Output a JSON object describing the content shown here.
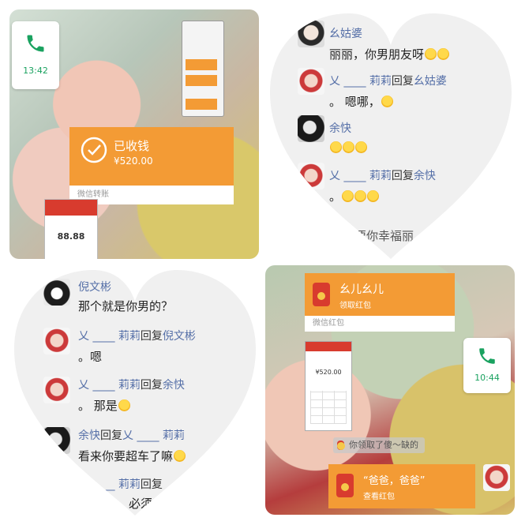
{
  "top_left": {
    "call": {
      "time": "13:42"
    },
    "transfer": {
      "title": "已收钱",
      "amount": "¥520.00",
      "footer": "微信转账"
    },
    "red_packet_amount": "88.88"
  },
  "top_right": {
    "messages": [
      {
        "name": "幺姑婆",
        "text": "丽丽，你男朋友呀"
      },
      {
        "name": "乂 ____ 莉莉",
        "reply_word": "回复",
        "reply_to": "幺姑婆",
        "text": "。 嗯哪，"
      },
      {
        "name": "余快",
        "text": ""
      },
      {
        "name": "乂 ____ 莉莉",
        "reply_word": "回复",
        "reply_to": "余快",
        "text": "。"
      },
      {
        "name": "",
        "text": "宝贝要你幸福丽"
      }
    ]
  },
  "bottom_left": {
    "messages": [
      {
        "name": "倪文彬",
        "text": "那个就是你男的？"
      },
      {
        "name": "乂 ____ 莉莉",
        "reply_word": "回复",
        "reply_to": "倪文彬",
        "text": "。嗯"
      },
      {
        "name": "乂 ____ 莉莉",
        "reply_word": "回复",
        "reply_to": "余快",
        "text": "。  那是"
      },
      {
        "name": "余快",
        "reply_word": "回复",
        "reply_to": "乂 ____ 莉莉",
        "text": "看来你要超车了嘛"
      },
      {
        "name": "乂 ____ 莉莉",
        "reply_word": "回复",
        "reply_to": "",
        "text": "必须"
      }
    ]
  },
  "bottom_right": {
    "top_packet": {
      "title": "幺儿幺儿",
      "subtitle": "领取红包",
      "footer": "微信红包"
    },
    "phone_amount": "¥520.00",
    "call": {
      "time": "10:44"
    },
    "notice": "你领取了傻～缺的",
    "bottom_packet": {
      "title": "“爸爸，爸爸”",
      "subtitle": "查看红包"
    }
  },
  "colors": {
    "orange": "#f39b35",
    "name_blue": "#5670a8",
    "call_green": "#1aa260",
    "red_packet": "#d83b2e"
  }
}
